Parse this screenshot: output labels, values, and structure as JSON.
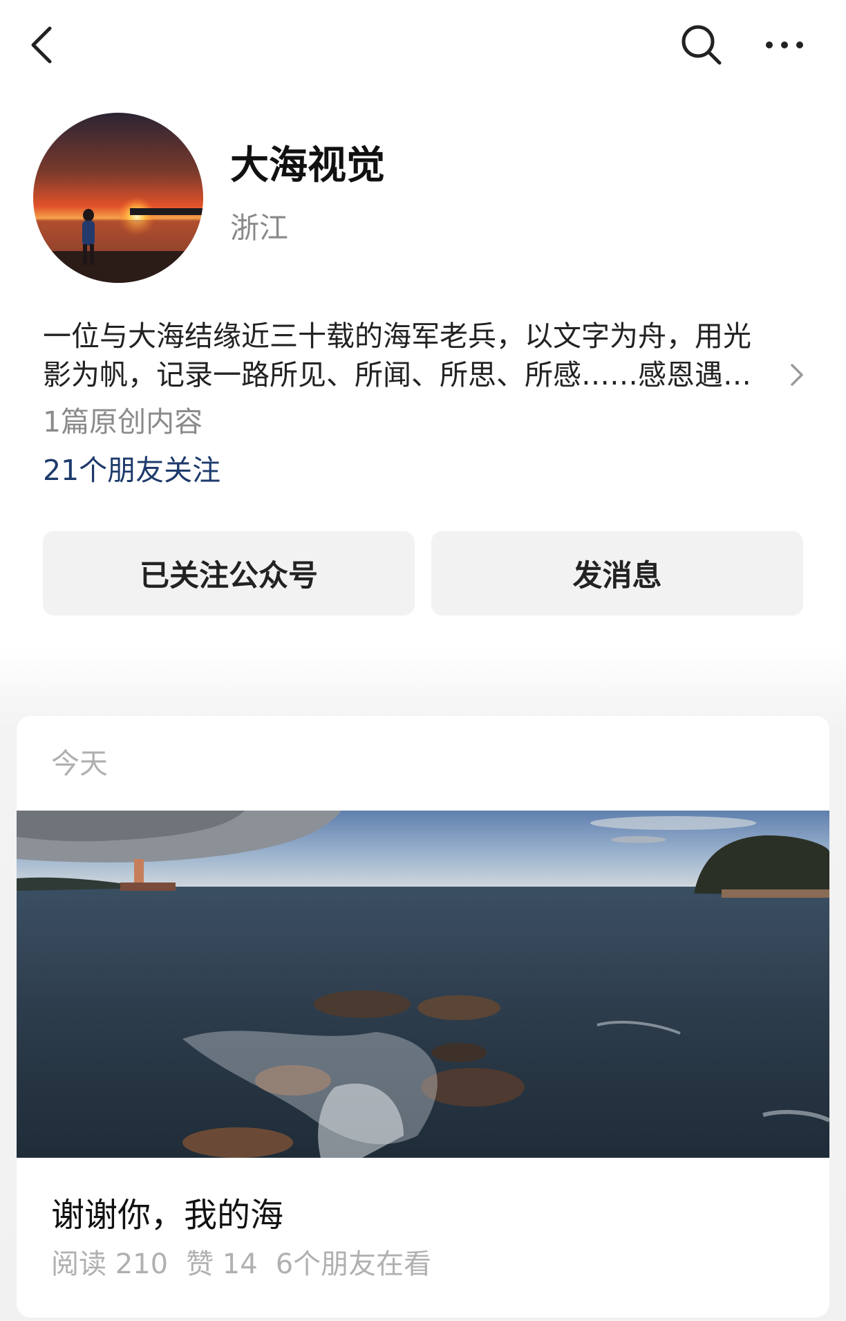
{
  "topbar": {
    "back_icon": "chevron-left-icon",
    "search_icon": "search-icon",
    "more_icon": "more-dots-icon"
  },
  "profile": {
    "name": "大海视觉",
    "region": "浙江",
    "bio_line1": "一位与大海结缘近三十载的海军老兵，以文字为舟，用光",
    "bio_line2": "影为帆，记录一路所见、所闻、所思、所感……感恩遇…",
    "original_count": "1篇原创内容",
    "friends_following": "21个朋友关注"
  },
  "actions": {
    "follow_label": "已关注公众号",
    "message_label": "发消息"
  },
  "feed": {
    "date": "今天",
    "article": {
      "title": "谢谢你，我的海",
      "reads": "阅读 210",
      "likes": "赞 14",
      "friends_viewing": "6个朋友在看"
    }
  },
  "colors": {
    "friends_link": "#1d3a6b",
    "muted": "#8a8a8a",
    "button_bg": "#f2f2f2"
  }
}
